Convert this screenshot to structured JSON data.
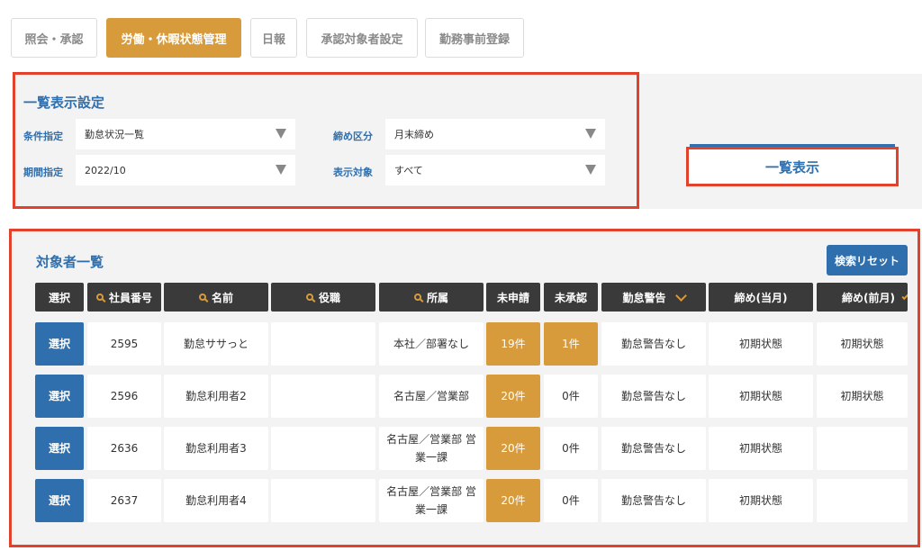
{
  "tabs": [
    {
      "label": "照会・承認",
      "active": false
    },
    {
      "label": "労働・休暇状態管理",
      "active": true
    },
    {
      "label": "日報",
      "active": false
    },
    {
      "label": "承認対象者設定",
      "active": false
    },
    {
      "label": "勤務事前登録",
      "active": false
    }
  ],
  "settings": {
    "title": "一覧表示設定",
    "condition": {
      "label": "条件指定",
      "value": "勤怠状況一覧"
    },
    "period": {
      "label": "期間指定",
      "value": "2022/10"
    },
    "closing": {
      "label": "締め区分",
      "value": "月末締め"
    },
    "target": {
      "label": "表示対象",
      "value": "すべて"
    },
    "show_button": "一覧表示"
  },
  "table": {
    "title": "対象者一覧",
    "reset_button": "検索リセット",
    "headers": [
      "選択",
      "社員番号",
      "名前",
      "役職",
      "所属",
      "未申請",
      "未承認",
      "勤怠警告",
      "締め(当月)",
      "締め(前月)"
    ],
    "rows": [
      {
        "select": "選択",
        "emp_no": "2595",
        "name": "勤怠ササっと",
        "position": "",
        "dept": "本社／部署なし",
        "unapplied": "19件",
        "unapproved": "1件",
        "warning": "勤怠警告なし",
        "close_cur": "初期状態",
        "close_prev": "初期状態"
      },
      {
        "select": "選択",
        "emp_no": "2596",
        "name": "勤怠利用者2",
        "position": "",
        "dept": "名古屋／営業部",
        "unapplied": "20件",
        "unapproved": "0件",
        "warning": "勤怠警告なし",
        "close_cur": "初期状態",
        "close_prev": "初期状態"
      },
      {
        "select": "選択",
        "emp_no": "2636",
        "name": "勤怠利用者3",
        "position": "",
        "dept": "名古屋／営業部 営業一課",
        "unapplied": "20件",
        "unapproved": "0件",
        "warning": "勤怠警告なし",
        "close_cur": "初期状態",
        "close_prev": ""
      },
      {
        "select": "選択",
        "emp_no": "2637",
        "name": "勤怠利用者4",
        "position": "",
        "dept": "名古屋／営業部 営業一課",
        "unapplied": "20件",
        "unapproved": "0件",
        "warning": "勤怠警告なし",
        "close_cur": "初期状態",
        "close_prev": ""
      }
    ]
  },
  "colors": {
    "accent": "#d89b3c",
    "primary": "#2f6fad",
    "highlight": "#e2412b",
    "header": "#3a3a3a"
  },
  "icons": {
    "search": "magnifier-icon",
    "dropdown": "chevron-down-icon",
    "select_arrow": "triangle-down-icon"
  }
}
